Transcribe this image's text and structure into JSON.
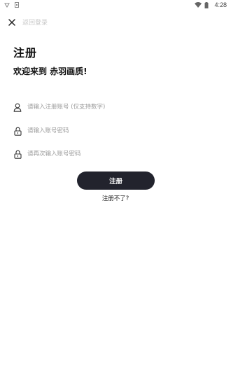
{
  "status_bar": {
    "time": "4:28",
    "icons": [
      "notification-icon",
      "sim-icon",
      "wifi-icon",
      "battery-icon"
    ]
  },
  "topbar": {
    "close_icon": "close-icon",
    "back_label": "返回登录"
  },
  "page": {
    "title": "注册",
    "welcome": "欢迎来到 赤羽画质!"
  },
  "form": {
    "account": {
      "icon": "user-icon",
      "placeholder": "请输入注册账号 (仅支持数字)",
      "value": ""
    },
    "password": {
      "icon": "lock-icon",
      "placeholder": "请输入账号密码",
      "value": ""
    },
    "confirm_password": {
      "icon": "lock-icon",
      "placeholder": "请再次输入账号密码",
      "value": ""
    }
  },
  "actions": {
    "register_label": "注册",
    "cant_register_label": "注册不了?"
  },
  "colors": {
    "button_bg": "#22232d",
    "button_text": "#ffffff",
    "placeholder": "#9a9a9a",
    "back_label": "#c8c8c8"
  }
}
